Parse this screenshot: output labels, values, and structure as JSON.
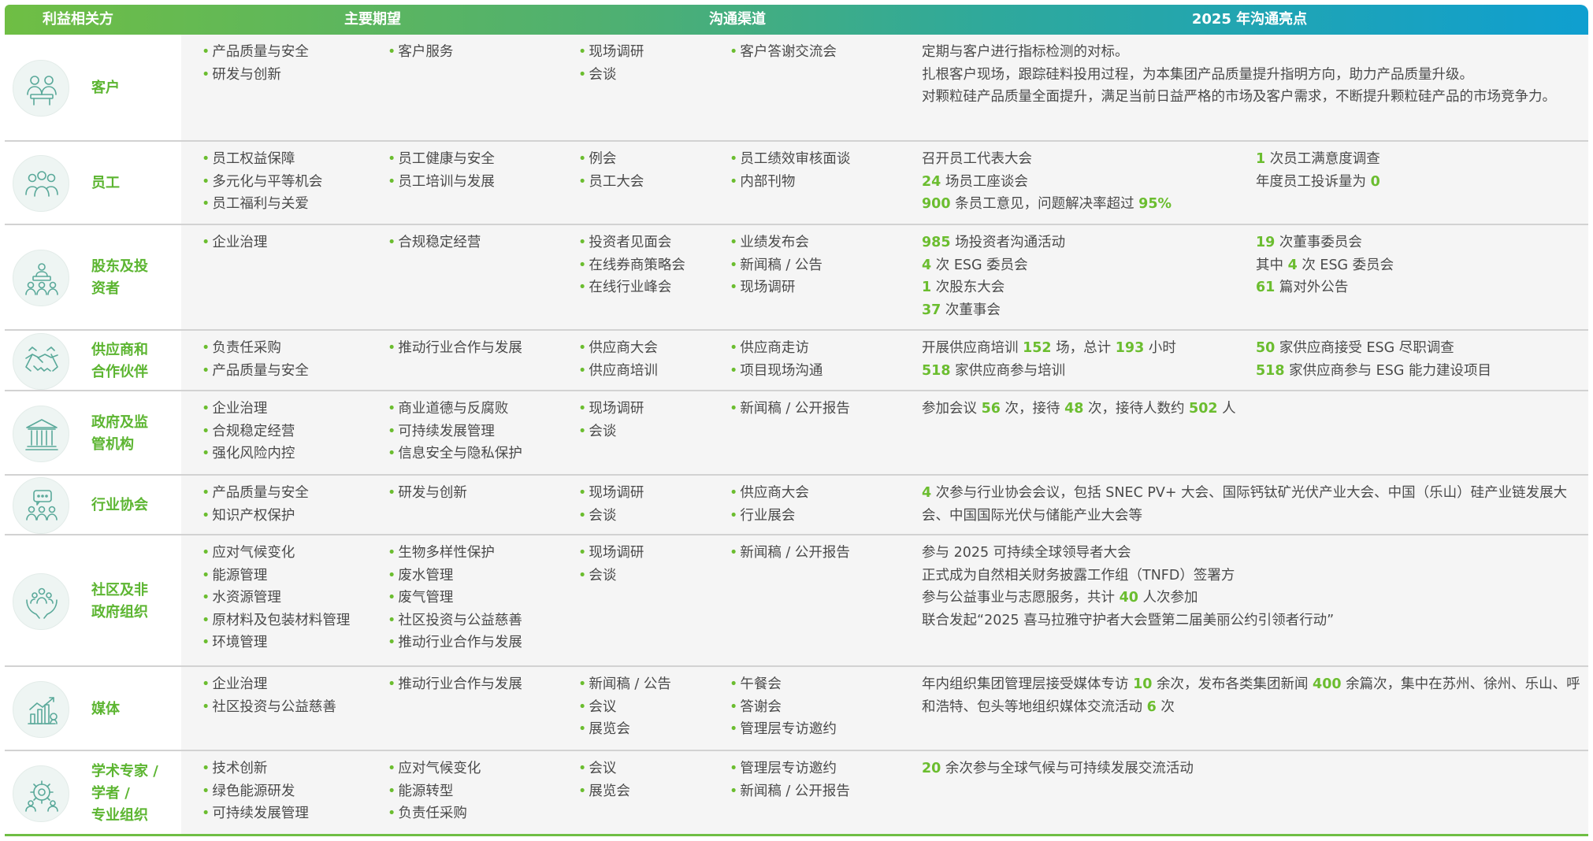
{
  "headers": [
    "利益相关方",
    "主要期望",
    "沟通渠道",
    "2025 年沟通亮点"
  ],
  "rows": [
    {
      "name": [
        "客户"
      ],
      "icon": "people-meeting-icon",
      "exp1": [
        "产品质量与安全",
        "研发与创新"
      ],
      "exp2": [
        "客户服务"
      ],
      "ch1": [
        "现场调研",
        "会谈"
      ],
      "ch2": [
        "客户答谢交流会"
      ],
      "hl1": [
        [
          {
            "t": "定期与客户进行指标检测的对标。"
          }
        ],
        [
          {
            "t": "扎根客户现场，跟踪硅料投用过程，为本集团产品质量提升指明方向，助力产品质量升级。"
          }
        ],
        [
          {
            "t": "对颗粒硅产品质量全面提升，满足当前日益严格的市场及客户需求，不断提升颗粒硅产品的市场竞争力。"
          }
        ]
      ],
      "hl2": []
    },
    {
      "name": [
        "员工"
      ],
      "icon": "employees-group-icon",
      "exp1": [
        "员工权益保障",
        "多元化与平等机会",
        "员工福利与关爱"
      ],
      "exp2": [
        "员工健康与安全",
        "员工培训与发展"
      ],
      "ch1": [
        "例会",
        "员工大会"
      ],
      "ch2": [
        "员工绩效审核面谈",
        "内部刊物"
      ],
      "hl1": [
        [
          {
            "t": "召开员工代表大会"
          }
        ],
        [
          {
            "t": "24",
            "n": true
          },
          {
            "t": " 场员工座谈会"
          }
        ],
        [
          {
            "t": "900",
            "n": true
          },
          {
            "t": " 条员工意见，问题解决率超过 "
          },
          {
            "t": "95%",
            "n": true
          }
        ]
      ],
      "hl2": [
        [
          {
            "t": "1",
            "n": true
          },
          {
            "t": " 次员工满意度调查"
          }
        ],
        [
          {
            "t": "年度员工投诉量为 "
          },
          {
            "t": "0",
            "n": true
          }
        ]
      ]
    },
    {
      "name": [
        "股东及投",
        "资者"
      ],
      "icon": "shareholders-icon",
      "exp1": [
        "企业治理"
      ],
      "exp2": [
        "合规稳定经营"
      ],
      "ch1": [
        "投资者见面会",
        "在线券商策略会",
        "在线行业峰会"
      ],
      "ch2": [
        "业绩发布会",
        "新闻稿 / 公告",
        "现场调研"
      ],
      "hl1": [
        [
          {
            "t": "985",
            "n": true
          },
          {
            "t": " 场投资者沟通活动"
          }
        ],
        [
          {
            "t": "4",
            "n": true
          },
          {
            "t": " 次 ESG 委员会"
          }
        ],
        [
          {
            "t": "1",
            "n": true
          },
          {
            "t": " 次股东大会"
          }
        ],
        [
          {
            "t": "37",
            "n": true
          },
          {
            "t": " 次董事会"
          }
        ]
      ],
      "hl2": [
        [
          {
            "t": "19",
            "n": true
          },
          {
            "t": " 次董事委员会"
          }
        ],
        [
          {
            "t": "其中 "
          },
          {
            "t": "4",
            "n": true
          },
          {
            "t": " 次 ESG 委员会"
          }
        ],
        [
          {
            "t": "61",
            "n": true
          },
          {
            "t": " 篇对外公告"
          }
        ]
      ]
    },
    {
      "name": [
        "供应商和",
        "合作伙伴"
      ],
      "icon": "handshake-icon",
      "exp1": [
        "负责任采购",
        "产品质量与安全"
      ],
      "exp2": [
        "推动行业合作与发展"
      ],
      "ch1": [
        "供应商大会",
        "供应商培训"
      ],
      "ch2": [
        "供应商走访",
        "项目现场沟通"
      ],
      "hl1": [
        [
          {
            "t": "开展供应商培训 "
          },
          {
            "t": "152",
            "n": true
          },
          {
            "t": " 场，总计 "
          },
          {
            "t": "193",
            "n": true
          },
          {
            "t": " 小时"
          }
        ],
        [
          {
            "t": "518",
            "n": true
          },
          {
            "t": " 家供应商参与培训"
          }
        ]
      ],
      "hl2": [
        [
          {
            "t": "50",
            "n": true
          },
          {
            "t": " 家供应商接受 ESG 尽职调查"
          }
        ],
        [
          {
            "t": "518",
            "n": true
          },
          {
            "t": " 家供应商参与 ESG 能力建设项目"
          }
        ]
      ]
    },
    {
      "name": [
        "政府及监",
        "管机构"
      ],
      "icon": "government-building-icon",
      "exp1": [
        "企业治理",
        "合规稳定经营",
        "强化风险内控"
      ],
      "exp2": [
        "商业道德与反腐败",
        "可持续发展管理",
        "信息安全与隐私保护"
      ],
      "ch1": [
        "现场调研",
        "会谈"
      ],
      "ch2": [
        "新闻稿 / 公开报告"
      ],
      "hl1": [
        [
          {
            "t": "参加会议 "
          },
          {
            "t": "56",
            "n": true
          },
          {
            "t": " 次，接待 "
          },
          {
            "t": "48",
            "n": true
          },
          {
            "t": " 次，接待人数约 "
          },
          {
            "t": "502",
            "n": true
          },
          {
            "t": " 人"
          }
        ]
      ],
      "hl2": []
    },
    {
      "name": [
        "行业协会"
      ],
      "icon": "association-chat-icon",
      "exp1": [
        "产品质量与安全",
        "知识产权保护"
      ],
      "exp2": [
        "研发与创新"
      ],
      "ch1": [
        "现场调研",
        "会谈"
      ],
      "ch2": [
        "供应商大会",
        "行业展会"
      ],
      "hl1": [
        [
          {
            "t": "4",
            "n": true
          },
          {
            "t": " 次参与行业协会会议，包括 SNEC PV+ 大会、国际钙钛矿光伏产业大会、中国（乐山）硅产业链发展大会、中国国际光伏与储能产业大会等"
          }
        ]
      ],
      "hl2": []
    },
    {
      "name": [
        "社区及非",
        "政府组织"
      ],
      "icon": "community-hands-icon",
      "exp1": [
        "应对气候变化",
        "能源管理",
        "水资源管理",
        "原材料及包装材料管理",
        "环境管理"
      ],
      "exp2": [
        "生物多样性保护",
        "废水管理",
        "废气管理",
        "社区投资与公益慈善",
        "推动行业合作与发展"
      ],
      "ch1": [
        "现场调研",
        "会谈"
      ],
      "ch2": [
        "新闻稿 / 公开报告"
      ],
      "hl1": [
        [
          {
            "t": "参与 2025 可持续全球领导者大会"
          }
        ],
        [
          {
            "t": "正式成为自然相关财务披露工作组（TNFD）签署方"
          }
        ],
        [
          {
            "t": "参与公益事业与志愿服务，共计 "
          },
          {
            "t": "40",
            "n": true
          },
          {
            "t": " 人次参加"
          }
        ],
        [
          {
            "t": "联合发起“2025 喜马拉雅守护者大会暨第二届美丽公约引领者行动”"
          }
        ]
      ],
      "hl2": []
    },
    {
      "name": [
        "媒体"
      ],
      "icon": "media-chart-icon",
      "exp1": [
        "企业治理",
        "社区投资与公益慈善"
      ],
      "exp2": [
        "推动行业合作与发展"
      ],
      "ch1": [
        "新闻稿 / 公告",
        "会议",
        "展览会"
      ],
      "ch2": [
        "午餐会",
        "答谢会",
        "管理层专访邀约"
      ],
      "hl1": [
        [
          {
            "t": "年内组织集团管理层接受媒体专访 "
          },
          {
            "t": "10",
            "n": true
          },
          {
            "t": " 余次，发布各类集团新闻 "
          },
          {
            "t": "400",
            "n": true
          },
          {
            "t": " 余篇次，集中在苏州、徐州、乐山、呼和浩特、包头等地组织媒体交流活动 "
          },
          {
            "t": "6",
            "n": true
          },
          {
            "t": " 次"
          }
        ]
      ],
      "hl2": []
    },
    {
      "name": [
        "学术专家 /",
        "学者 /",
        "专业组织"
      ],
      "icon": "experts-gear-icon",
      "exp1": [
        "技术创新",
        "绿色能源研发",
        "可持续发展管理"
      ],
      "exp2": [
        "应对气候变化",
        "能源转型",
        "负责任采购"
      ],
      "ch1": [
        "会议",
        "展览会"
      ],
      "ch2": [
        "管理层专访邀约",
        "新闻稿 / 公开报告"
      ],
      "hl1": [
        [
          {
            "t": "20",
            "n": true
          },
          {
            "t": " 余次参与全球气候与可持续发展交流活动"
          }
        ]
      ],
      "hl2": []
    }
  ],
  "colors": {
    "accent": "#6bbd2f",
    "header_start": "#6fbe44",
    "header_end": "#0f9fd0",
    "icon_line": "#5aa99a"
  }
}
